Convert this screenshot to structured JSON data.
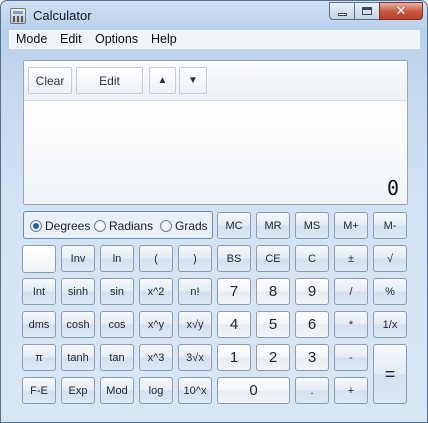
{
  "window": {
    "title": "Calculator",
    "close_symbol": "✕"
  },
  "menu": [
    "Mode",
    "Edit",
    "Options",
    "Help"
  ],
  "history": {
    "clear": "Clear",
    "edit": "Edit",
    "up": "▲",
    "down": "▼"
  },
  "display": {
    "value": "0"
  },
  "angle_units": [
    "Degrees",
    "Radians",
    "Grads"
  ],
  "angle_selected": "Degrees",
  "memory_keys": [
    "MC",
    "MR",
    "MS",
    "M+",
    "M-"
  ],
  "keys": {
    "inv": "Inv",
    "ln": "ln",
    "lparen": "(",
    "rparen": ")",
    "bs": "BS",
    "ce": "CE",
    "c": "C",
    "pm": "±",
    "sqrt": "√",
    "int": "Int",
    "sinh": "sinh",
    "sin": "sin",
    "x2": "x^2",
    "nfact": "n!",
    "seven": "7",
    "eight": "8",
    "nine": "9",
    "div": "/",
    "pct": "%",
    "dms": "dms",
    "cosh": "cosh",
    "cos": "cos",
    "xy": "x^y",
    "yroot": "x√y",
    "four": "4",
    "five": "5",
    "six": "6",
    "mul": "*",
    "recip": "1/x",
    "pi": "π",
    "tanh": "tanh",
    "tan": "tan",
    "x3": "x^3",
    "cbrt": "3√x",
    "one": "1",
    "two": "2",
    "three": "3",
    "minus": "-",
    "fe": "F-E",
    "exp": "Exp",
    "mod": "Mod",
    "log": "log",
    "tenx": "10^x",
    "zero": "0",
    "dot": ".",
    "plus": "+",
    "eq": "="
  }
}
